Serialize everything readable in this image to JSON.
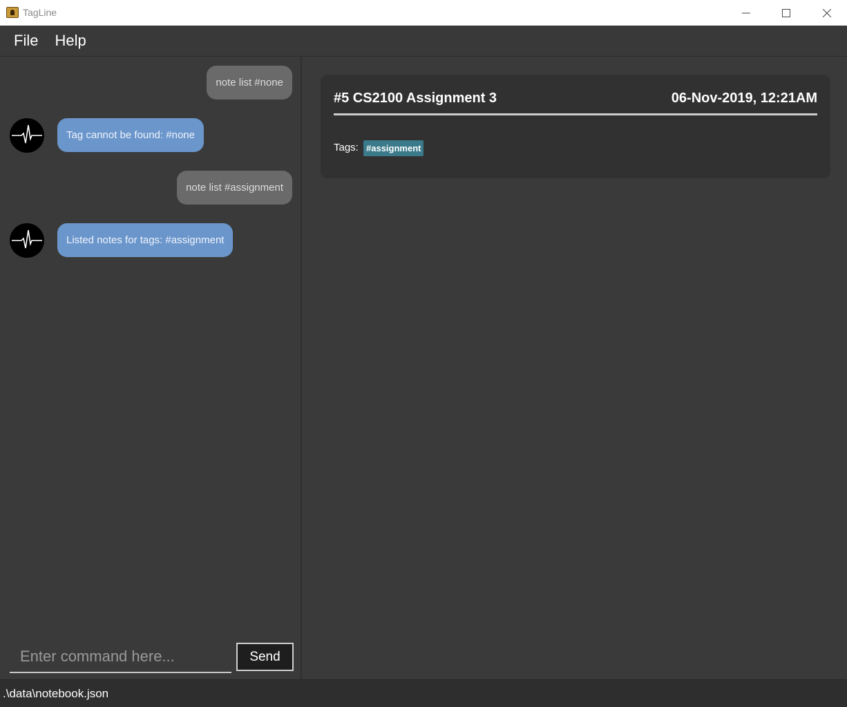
{
  "window": {
    "title": "TagLine"
  },
  "menu": {
    "items": [
      {
        "label": "File"
      },
      {
        "label": "Help"
      }
    ]
  },
  "chat": {
    "messages": [
      {
        "sender": "user",
        "text": "note list #none"
      },
      {
        "sender": "bot",
        "text": "Tag cannot be found: #none"
      },
      {
        "sender": "user",
        "text": "note list #assignment"
      },
      {
        "sender": "bot",
        "text": "Listed notes for tags: #assignment"
      }
    ],
    "input": {
      "placeholder": "Enter command here...",
      "value": ""
    },
    "send_label": "Send"
  },
  "note": {
    "title": "#5 CS2100 Assignment 3",
    "date": "06-Nov-2019, 12:21AM",
    "tags_label": "Tags:",
    "tags": [
      "#assignment"
    ]
  },
  "status": {
    "path": ".\\data\\notebook.json"
  },
  "colors": {
    "user_bubble": "#6a6a6a",
    "bot_bubble": "#6b96cc",
    "tag_chip": "#3a7a8a",
    "background": "#3a3a3a"
  },
  "icons": {
    "bot_avatar": "heartbeat-icon",
    "app": "tagline-app-icon"
  }
}
